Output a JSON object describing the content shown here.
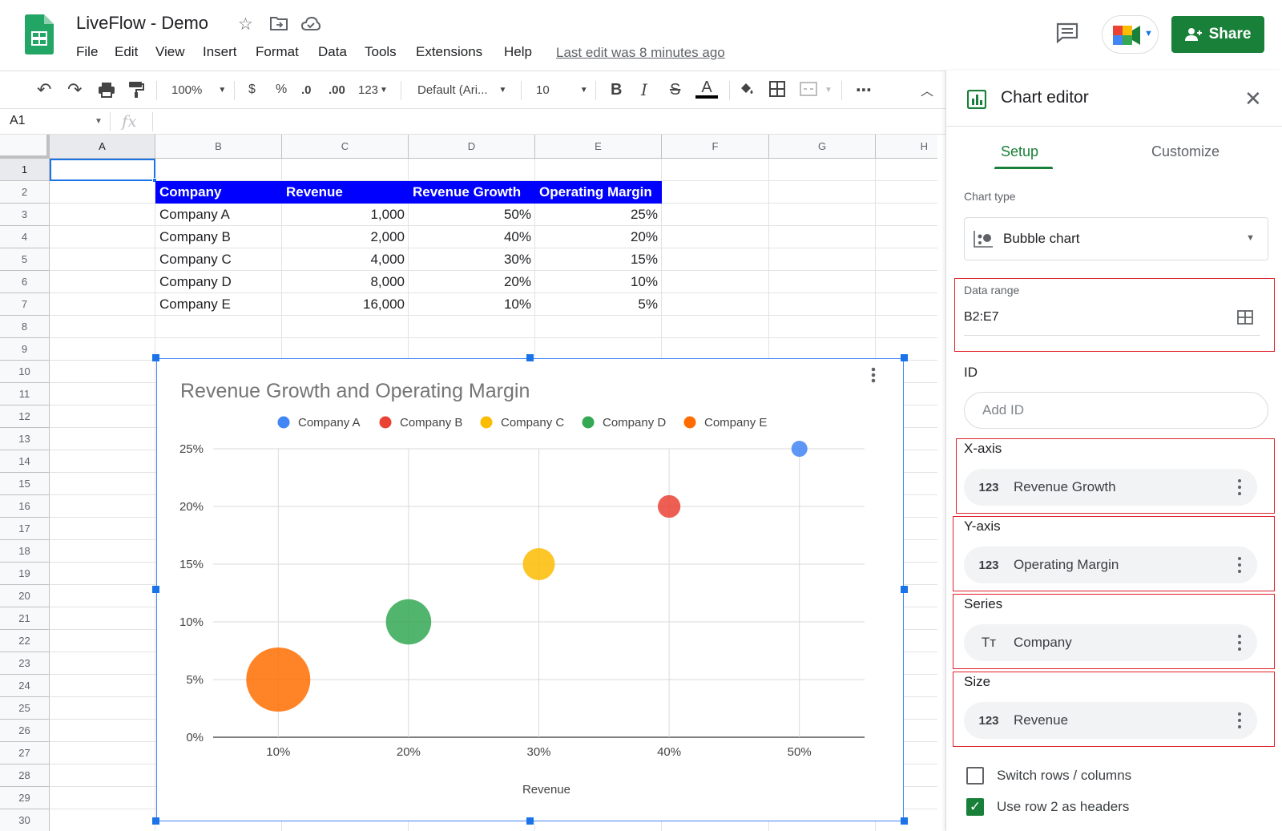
{
  "app": {
    "doc_title": "LiveFlow - Demo",
    "menu": [
      "File",
      "Edit",
      "View",
      "Insert",
      "Format",
      "Data",
      "Tools",
      "Extensions",
      "Help"
    ],
    "last_edit": "Last edit was 8 minutes ago",
    "share_label": "Share"
  },
  "toolbar": {
    "zoom": "100%",
    "currency": "$",
    "percent": "%",
    "dec_decrease": ".0",
    "dec_increase": ".00",
    "more_formats": "123",
    "font": "Default (Ari...",
    "font_size": "10",
    "bold": "B",
    "italic": "I",
    "strike": "S",
    "text_color": "A",
    "more": "⋯"
  },
  "formula_bar": {
    "name_box": "A1",
    "fx": "fx"
  },
  "columns": [
    "A",
    "B",
    "C",
    "D",
    "E",
    "F",
    "G",
    "H"
  ],
  "rows": [
    "1",
    "2",
    "3",
    "4",
    "5",
    "6",
    "7",
    "8",
    "9",
    "10",
    "11",
    "12",
    "13",
    "14",
    "15",
    "16",
    "17",
    "18",
    "19",
    "20",
    "21",
    "22",
    "23",
    "24",
    "25",
    "26",
    "27",
    "28",
    "29",
    "30"
  ],
  "table": {
    "headers": [
      "Company",
      "Revenue",
      "Revenue Growth",
      "Operating Margin"
    ],
    "rows": [
      [
        "Company A",
        "1,000",
        "50%",
        "25%"
      ],
      [
        "Company B",
        "2,000",
        "40%",
        "20%"
      ],
      [
        "Company C",
        "4,000",
        "30%",
        "15%"
      ],
      [
        "Company D",
        "8,000",
        "20%",
        "10%"
      ],
      [
        "Company E",
        "16,000",
        "10%",
        "5%"
      ]
    ]
  },
  "chart_data": {
    "type": "scatter",
    "subtype": "bubble",
    "title": "Revenue Growth and Operating Margin",
    "xlabel": "Revenue",
    "ylabel": "",
    "xlim": [
      0.05,
      0.55
    ],
    "ylim": [
      0,
      0.25
    ],
    "x_ticks": [
      "10%",
      "20%",
      "30%",
      "40%",
      "50%"
    ],
    "y_ticks": [
      "0%",
      "5%",
      "10%",
      "15%",
      "20%",
      "25%"
    ],
    "grid": true,
    "legend": "top",
    "series": [
      {
        "name": "Company A",
        "x": 0.5,
        "y": 0.25,
        "size": 1000,
        "color": "#4285f4"
      },
      {
        "name": "Company B",
        "x": 0.4,
        "y": 0.2,
        "size": 2000,
        "color": "#ea4335"
      },
      {
        "name": "Company C",
        "x": 0.3,
        "y": 0.15,
        "size": 4000,
        "color": "#fbbc04"
      },
      {
        "name": "Company D",
        "x": 0.2,
        "y": 0.1,
        "size": 8000,
        "color": "#34a853"
      },
      {
        "name": "Company E",
        "x": 0.1,
        "y": 0.05,
        "size": 16000,
        "color": "#ff6d01"
      }
    ]
  },
  "editor": {
    "title": "Chart editor",
    "tabs": [
      "Setup",
      "Customize"
    ],
    "chart_type_label": "Chart type",
    "chart_type_value": "Bubble chart",
    "data_range_label": "Data range",
    "data_range_value": "B2:E7",
    "id_label": "ID",
    "id_placeholder": "Add ID",
    "x_axis_label": "X-axis",
    "x_axis_value": "Revenue Growth",
    "y_axis_label": "Y-axis",
    "y_axis_value": "Operating Margin",
    "series_label": "Series",
    "series_value": "Company",
    "size_label": "Size",
    "size_value": "Revenue",
    "num_icon": "123",
    "text_icon": "Tт",
    "switch_rows_label": "Switch rows / columns",
    "use_headers_label": "Use row 2 as headers",
    "switch_rows_checked": false,
    "use_headers_checked": true
  }
}
